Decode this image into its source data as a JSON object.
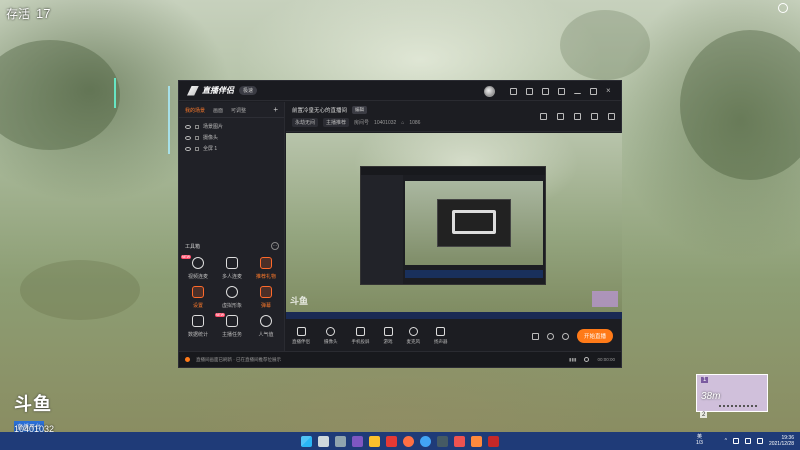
{
  "hud": {
    "label": "存活",
    "count": "17"
  },
  "app": {
    "title": "直播伴侣",
    "version_badge": "极速",
    "left_tabs": [
      "我的场景",
      "画面",
      "可调整"
    ],
    "add_label": "+",
    "scenes": [
      "场景图片",
      "摄像头",
      "全屏 1"
    ],
    "toolbox": {
      "title": "工具箱",
      "more": "···",
      "tools": [
        {
          "label": "视频连麦",
          "badge": "NEW",
          "accent": false
        },
        {
          "label": "多人连麦",
          "badge": "",
          "accent": false
        },
        {
          "label": "推荐礼物",
          "badge": "",
          "accent": true
        },
        {
          "label": "设置",
          "badge": "",
          "accent": true
        },
        {
          "label": "虚拟形象",
          "badge": "",
          "accent": false
        },
        {
          "label": "弹幕",
          "badge": "",
          "accent": true
        },
        {
          "label": "数据统计",
          "badge": "",
          "accent": false
        },
        {
          "label": "主播任务",
          "badge": "NEW",
          "accent": false
        },
        {
          "label": "人气值",
          "badge": "",
          "accent": false
        }
      ]
    },
    "stream_title": "前置冷皇无心的直播间",
    "edit_label": "编辑",
    "meta": {
      "category": "永劫无间",
      "tag": "主播推荐",
      "room_label": "房间号",
      "room_id": "10401032",
      "popularity": "1086"
    },
    "controls": [
      "直播伴侣",
      "摄像头",
      "手机投屏",
      "游戏",
      "麦克风",
      "扬声器"
    ],
    "live_button": "开始直播",
    "status_text": "直播间画面已刷新 · 已在直播间推荐位展示",
    "timer": "00:00:00"
  },
  "watermark": {
    "logo": "斗鱼",
    "sub": "直播平台",
    "room_id": "10401032"
  },
  "game_widget": {
    "rank_top": "1",
    "value": "38m",
    "rank_bottom": "2"
  },
  "taskbar": {
    "lang_line1": "英",
    "lang_line2": "1/3",
    "time": "19:36",
    "date": "2021/12/28"
  },
  "colors": {
    "accent": "#ff7a18",
    "app_bg": "#1c1d22",
    "taskbar": "#1f3b78"
  }
}
